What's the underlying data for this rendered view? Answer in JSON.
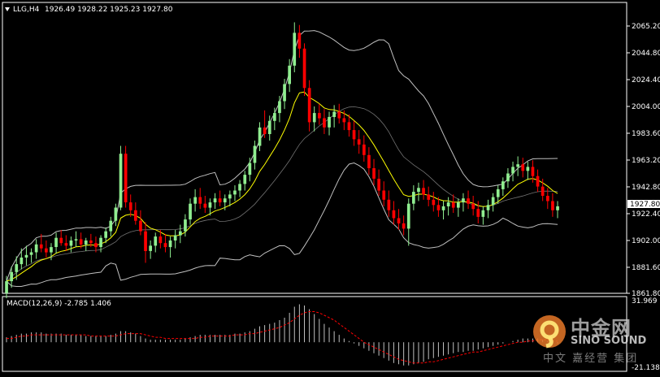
{
  "header": {
    "symbol_label": "LLG,H4",
    "ohlc_label": "1926.49 1928.22 1925.23 1927.80"
  },
  "macd_header": {
    "label": "MACD(12,26,9) -2.785 1.406"
  },
  "price_badge": "1927.80",
  "price_axis_ticks": [
    "2065.20",
    "2044.80",
    "2024.40",
    "2004.00",
    "1983.60",
    "1963.20",
    "1942.80",
    "1922.40",
    "1902.00",
    "1881.60",
    "1861.80"
  ],
  "macd_axis_ticks": [
    "31.969",
    "-21.138"
  ],
  "watermark": {
    "cn_text": "中金网",
    "en_text": "SINO SOUND",
    "sub_text": "中文 嘉经营 集团"
  },
  "colors": {
    "background": "#000000",
    "frame": "#ffffff",
    "bull_candle": "#90ee90",
    "bear_candle": "#ff0000",
    "bollinger": "#c0c0c0",
    "ma_line": "#ffff00",
    "macd_hist": "#c0c0c0",
    "macd_signal": "#ff0000",
    "text": "#ffffff"
  },
  "chart_data": {
    "type": "candlestick",
    "price_range": [
      1861.8,
      2072.0
    ],
    "macd_range": [
      -21.138,
      31.969
    ],
    "candles": [
      [
        1862,
        1875,
        1858,
        1871
      ],
      [
        1871,
        1882,
        1866,
        1878
      ],
      [
        1878,
        1890,
        1872,
        1884
      ],
      [
        1884,
        1896,
        1880,
        1889
      ],
      [
        1889,
        1898,
        1883,
        1891
      ],
      [
        1891,
        1896,
        1885,
        1893
      ],
      [
        1893,
        1903,
        1888,
        1899
      ],
      [
        1899,
        1907,
        1893,
        1896
      ],
      [
        1896,
        1902,
        1889,
        1893
      ],
      [
        1893,
        1900,
        1887,
        1897
      ],
      [
        1897,
        1908,
        1892,
        1904
      ],
      [
        1904,
        1910,
        1898,
        1900
      ],
      [
        1900,
        1906,
        1894,
        1898
      ],
      [
        1898,
        1905,
        1893,
        1902
      ],
      [
        1902,
        1909,
        1897,
        1903
      ],
      [
        1903,
        1908,
        1896,
        1899
      ],
      [
        1899,
        1904,
        1894,
        1902
      ],
      [
        1902,
        1907,
        1897,
        1900
      ],
      [
        1900,
        1905,
        1893,
        1897
      ],
      [
        1897,
        1906,
        1893,
        1904
      ],
      [
        1904,
        1912,
        1900,
        1909
      ],
      [
        1909,
        1920,
        1905,
        1917
      ],
      [
        1917,
        1930,
        1913,
        1927
      ],
      [
        1927,
        1974,
        1925,
        1968
      ],
      [
        1968,
        1974,
        1927,
        1931
      ],
      [
        1931,
        1937,
        1920,
        1925
      ],
      [
        1925,
        1931,
        1914,
        1917
      ],
      [
        1917,
        1925,
        1906,
        1909
      ],
      [
        1909,
        1916,
        1885,
        1894
      ],
      [
        1894,
        1902,
        1888,
        1898
      ],
      [
        1898,
        1908,
        1893,
        1905
      ],
      [
        1905,
        1910,
        1896,
        1900
      ],
      [
        1900,
        1907,
        1893,
        1897
      ],
      [
        1897,
        1905,
        1889,
        1902
      ],
      [
        1902,
        1910,
        1896,
        1906
      ],
      [
        1906,
        1914,
        1900,
        1909
      ],
      [
        1909,
        1922,
        1905,
        1918
      ],
      [
        1918,
        1934,
        1914,
        1930
      ],
      [
        1930,
        1941,
        1924,
        1935
      ],
      [
        1935,
        1942,
        1926,
        1930
      ],
      [
        1930,
        1936,
        1923,
        1927
      ],
      [
        1927,
        1934,
        1921,
        1931
      ],
      [
        1931,
        1938,
        1926,
        1934
      ],
      [
        1934,
        1940,
        1928,
        1931
      ],
      [
        1931,
        1937,
        1925,
        1934
      ],
      [
        1934,
        1940,
        1928,
        1937
      ],
      [
        1937,
        1944,
        1932,
        1940
      ],
      [
        1940,
        1948,
        1935,
        1945
      ],
      [
        1945,
        1955,
        1940,
        1952
      ],
      [
        1952,
        1965,
        1947,
        1961
      ],
      [
        1961,
        1978,
        1956,
        1974
      ],
      [
        1974,
        1992,
        1970,
        1988
      ],
      [
        1988,
        2001,
        1980,
        1983
      ],
      [
        1983,
        1997,
        1978,
        1993
      ],
      [
        1993,
        2003,
        1986,
        1999
      ],
      [
        1999,
        2012,
        1992,
        2008
      ],
      [
        2008,
        2025,
        2002,
        2021
      ],
      [
        2021,
        2040,
        2015,
        2035
      ],
      [
        2035,
        2068,
        2030,
        2060
      ],
      [
        2060,
        2066,
        2041,
        2048
      ],
      [
        2048,
        2052,
        2012,
        2018
      ],
      [
        2018,
        2024,
        1985,
        1992
      ],
      [
        1992,
        2004,
        1985,
        1999
      ],
      [
        1999,
        2006,
        1990,
        1995
      ],
      [
        1995,
        2002,
        1983,
        1988
      ],
      [
        1988,
        2000,
        1982,
        1996
      ],
      [
        1996,
        2005,
        1988,
        2000
      ],
      [
        2000,
        2006,
        1991,
        1995
      ],
      [
        1995,
        2001,
        1986,
        1992
      ],
      [
        1992,
        1998,
        1981,
        1986
      ],
      [
        1986,
        1993,
        1974,
        1979
      ],
      [
        1979,
        1986,
        1968,
        1975
      ],
      [
        1975,
        1982,
        1962,
        1967
      ],
      [
        1967,
        1973,
        1952,
        1957
      ],
      [
        1957,
        1964,
        1944,
        1949
      ],
      [
        1949,
        1956,
        1936,
        1940
      ],
      [
        1940,
        1947,
        1928,
        1933
      ],
      [
        1933,
        1940,
        1920,
        1925
      ],
      [
        1925,
        1932,
        1914,
        1919
      ],
      [
        1919,
        1926,
        1910,
        1915
      ],
      [
        1915,
        1921,
        1906,
        1911
      ],
      [
        1911,
        1934,
        1898,
        1930
      ],
      [
        1930,
        1944,
        1925,
        1939
      ],
      [
        1939,
        1946,
        1932,
        1942
      ],
      [
        1942,
        1948,
        1933,
        1937
      ],
      [
        1937,
        1943,
        1928,
        1933
      ],
      [
        1933,
        1939,
        1924,
        1929
      ],
      [
        1929,
        1935,
        1920,
        1925
      ],
      [
        1925,
        1932,
        1918,
        1928
      ],
      [
        1928,
        1935,
        1921,
        1931
      ],
      [
        1931,
        1937,
        1923,
        1927
      ],
      [
        1927,
        1934,
        1920,
        1931
      ],
      [
        1931,
        1938,
        1924,
        1934
      ],
      [
        1934,
        1940,
        1926,
        1930
      ],
      [
        1930,
        1936,
        1921,
        1926
      ],
      [
        1926,
        1932,
        1915,
        1920
      ],
      [
        1920,
        1928,
        1914,
        1925
      ],
      [
        1925,
        1933,
        1919,
        1929
      ],
      [
        1929,
        1938,
        1924,
        1935
      ],
      [
        1935,
        1944,
        1930,
        1941
      ],
      [
        1941,
        1950,
        1936,
        1947
      ],
      [
        1947,
        1957,
        1942,
        1953
      ],
      [
        1953,
        1962,
        1947,
        1958
      ],
      [
        1958,
        1966,
        1951,
        1960
      ],
      [
        1960,
        1965,
        1950,
        1955
      ],
      [
        1955,
        1962,
        1948,
        1958
      ],
      [
        1958,
        1963,
        1946,
        1951
      ],
      [
        1951,
        1956,
        1939,
        1943
      ],
      [
        1943,
        1949,
        1932,
        1936
      ],
      [
        1936,
        1942,
        1926,
        1932
      ],
      [
        1932,
        1938,
        1920,
        1925
      ],
      [
        1925,
        1932,
        1919,
        1928
      ]
    ],
    "macd_histogram": [
      4,
      5,
      6,
      7,
      7,
      8,
      8,
      8,
      7,
      7,
      7,
      7,
      6,
      6,
      6,
      6,
      5,
      5,
      5,
      5,
      5,
      6,
      7,
      9,
      9,
      8,
      7,
      5,
      3,
      2,
      2,
      2,
      2,
      2,
      2,
      2,
      3,
      4,
      5,
      6,
      6,
      6,
      6,
      6,
      6,
      6,
      7,
      7,
      8,
      9,
      11,
      13,
      14,
      15,
      16,
      18,
      20,
      24,
      29,
      31,
      30,
      27,
      23,
      19,
      15,
      12,
      9,
      6,
      3,
      1,
      -1,
      -3,
      -5,
      -7,
      -9,
      -11,
      -13,
      -15,
      -17,
      -18,
      -19,
      -19,
      -18,
      -17,
      -16,
      -14,
      -13,
      -12,
      -11,
      -10,
      -9,
      -8,
      -8,
      -7,
      -7,
      -6,
      -5,
      -4,
      -3,
      -2,
      -1,
      0,
      1,
      2,
      3,
      3,
      3,
      3,
      2,
      1,
      0,
      -1
    ],
    "macd_signal": [
      3,
      3,
      4,
      5,
      5,
      6,
      6,
      6,
      6,
      6,
      6,
      6,
      6,
      6,
      6,
      6,
      6,
      5,
      5,
      5,
      5,
      5,
      5,
      6,
      7,
      7,
      7,
      7,
      6,
      5,
      4,
      4,
      3,
      3,
      3,
      3,
      3,
      3,
      3,
      4,
      4,
      5,
      5,
      5,
      5,
      5,
      6,
      6,
      6,
      7,
      7,
      8,
      9,
      10,
      11,
      12,
      14,
      16,
      19,
      22,
      24,
      25,
      25,
      24,
      22,
      20,
      18,
      15,
      12,
      9,
      6,
      3,
      0,
      -2,
      -4,
      -6,
      -8,
      -10,
      -12,
      -14,
      -15,
      -16,
      -17,
      -17,
      -17,
      -16,
      -16,
      -15,
      -14,
      -13,
      -12,
      -11,
      -10,
      -9,
      -8,
      -8,
      -7,
      -6,
      -5,
      -4,
      -3,
      -2,
      -1,
      0,
      0,
      1,
      1,
      2,
      2,
      2,
      1,
      1
    ]
  }
}
